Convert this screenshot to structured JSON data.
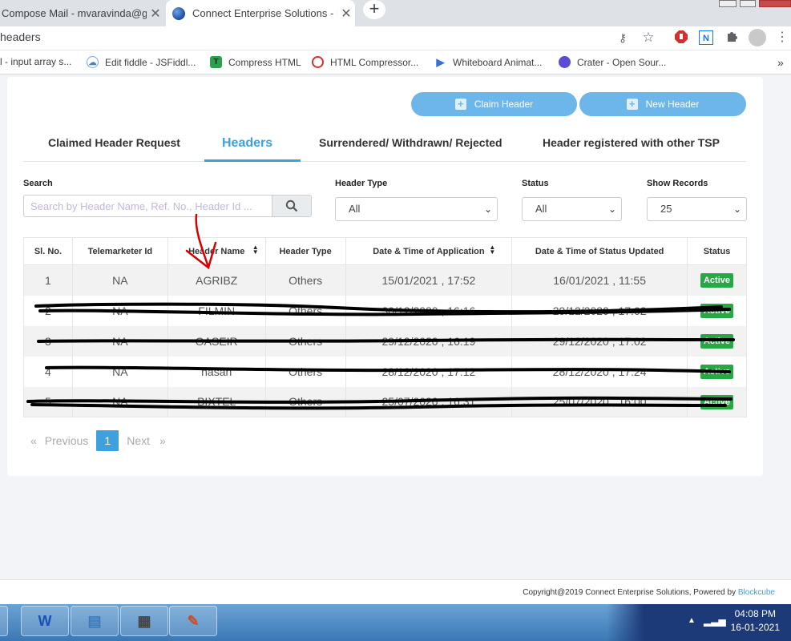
{
  "browser": {
    "tabs": [
      {
        "title": "Compose Mail - mvaravinda@gm",
        "close": "✕"
      },
      {
        "title": "Connect Enterprise Solutions - En",
        "close": "✕"
      }
    ],
    "new_tab": "+",
    "url": "headers",
    "bookmarks": [
      {
        "label": "l - input array s...",
        "icon": "none"
      },
      {
        "label": "Edit fiddle - JSFiddl...",
        "icon": "cloud-icon"
      },
      {
        "label": "Compress HTML",
        "icon": "T"
      },
      {
        "label": "HTML Compressor...",
        "icon": "html-icon"
      },
      {
        "label": "Whiteboard Animat...",
        "icon": "play-icon"
      },
      {
        "label": "Crater - Open Sour...",
        "icon": "crater-icon"
      }
    ],
    "bookmarks_more": "»"
  },
  "actions": {
    "claim_header": "Claim Header",
    "new_header": "New Header"
  },
  "tabs": [
    {
      "label": "Claimed Header Request"
    },
    {
      "label": "Headers"
    },
    {
      "label": "Surrendered/ Withdrawn/ Rejected"
    },
    {
      "label": "Header registered with other TSP"
    }
  ],
  "filters": {
    "search_label": "Search",
    "search_placeholder": "Search by Header Name, Ref. No., Header Id ...",
    "header_type_label": "Header Type",
    "header_type_value": "All",
    "status_label": "Status",
    "status_value": "All",
    "show_records_label": "Show Records",
    "show_records_value": "25"
  },
  "table": {
    "headers": [
      "Sl. No.",
      "Telemarketer Id",
      "Header Name",
      "Header Type",
      "Date & Time of Application",
      "Date & Time of Status Updated",
      "Status"
    ],
    "rows": [
      [
        "1",
        "NA",
        "AGRIBZ",
        "Others",
        "15/01/2021 , 17:52",
        "16/01/2021 , 11:55",
        "Active"
      ],
      [
        "2",
        "NA",
        "FILMIN",
        "Others",
        "30/12/2020 , 16:16",
        "29/12/2020 , 17:02",
        "Active"
      ],
      [
        "3",
        "NA",
        "OASEIR",
        "Others",
        "29/12/2020 , 16:19",
        "29/12/2020 , 17:02",
        "Active"
      ],
      [
        "4",
        "NA",
        "hasan",
        "Others",
        "28/12/2020 , 17:12",
        "28/12/2020 , 17:24",
        "Active"
      ],
      [
        "5",
        "NA",
        "BIXTEL",
        "Others",
        "25/07/2020 , 16:31",
        "25/07/2020 , 16:00",
        "Active"
      ]
    ]
  },
  "pagination": {
    "previous": "Previous",
    "current": "1",
    "next": "Next",
    "prev_arrow": "«",
    "next_arrow": "»"
  },
  "footer": {
    "text": "Copyright@2019 Connect Enterprise Solutions, Powered by",
    "link": "Blockcube"
  },
  "taskbar": {
    "time": "04:08 PM",
    "date": "16-01-2021"
  },
  "colors": {
    "accent": "#3ea0dc",
    "button": "#6cb6e9",
    "active_badge": "#28a745"
  }
}
